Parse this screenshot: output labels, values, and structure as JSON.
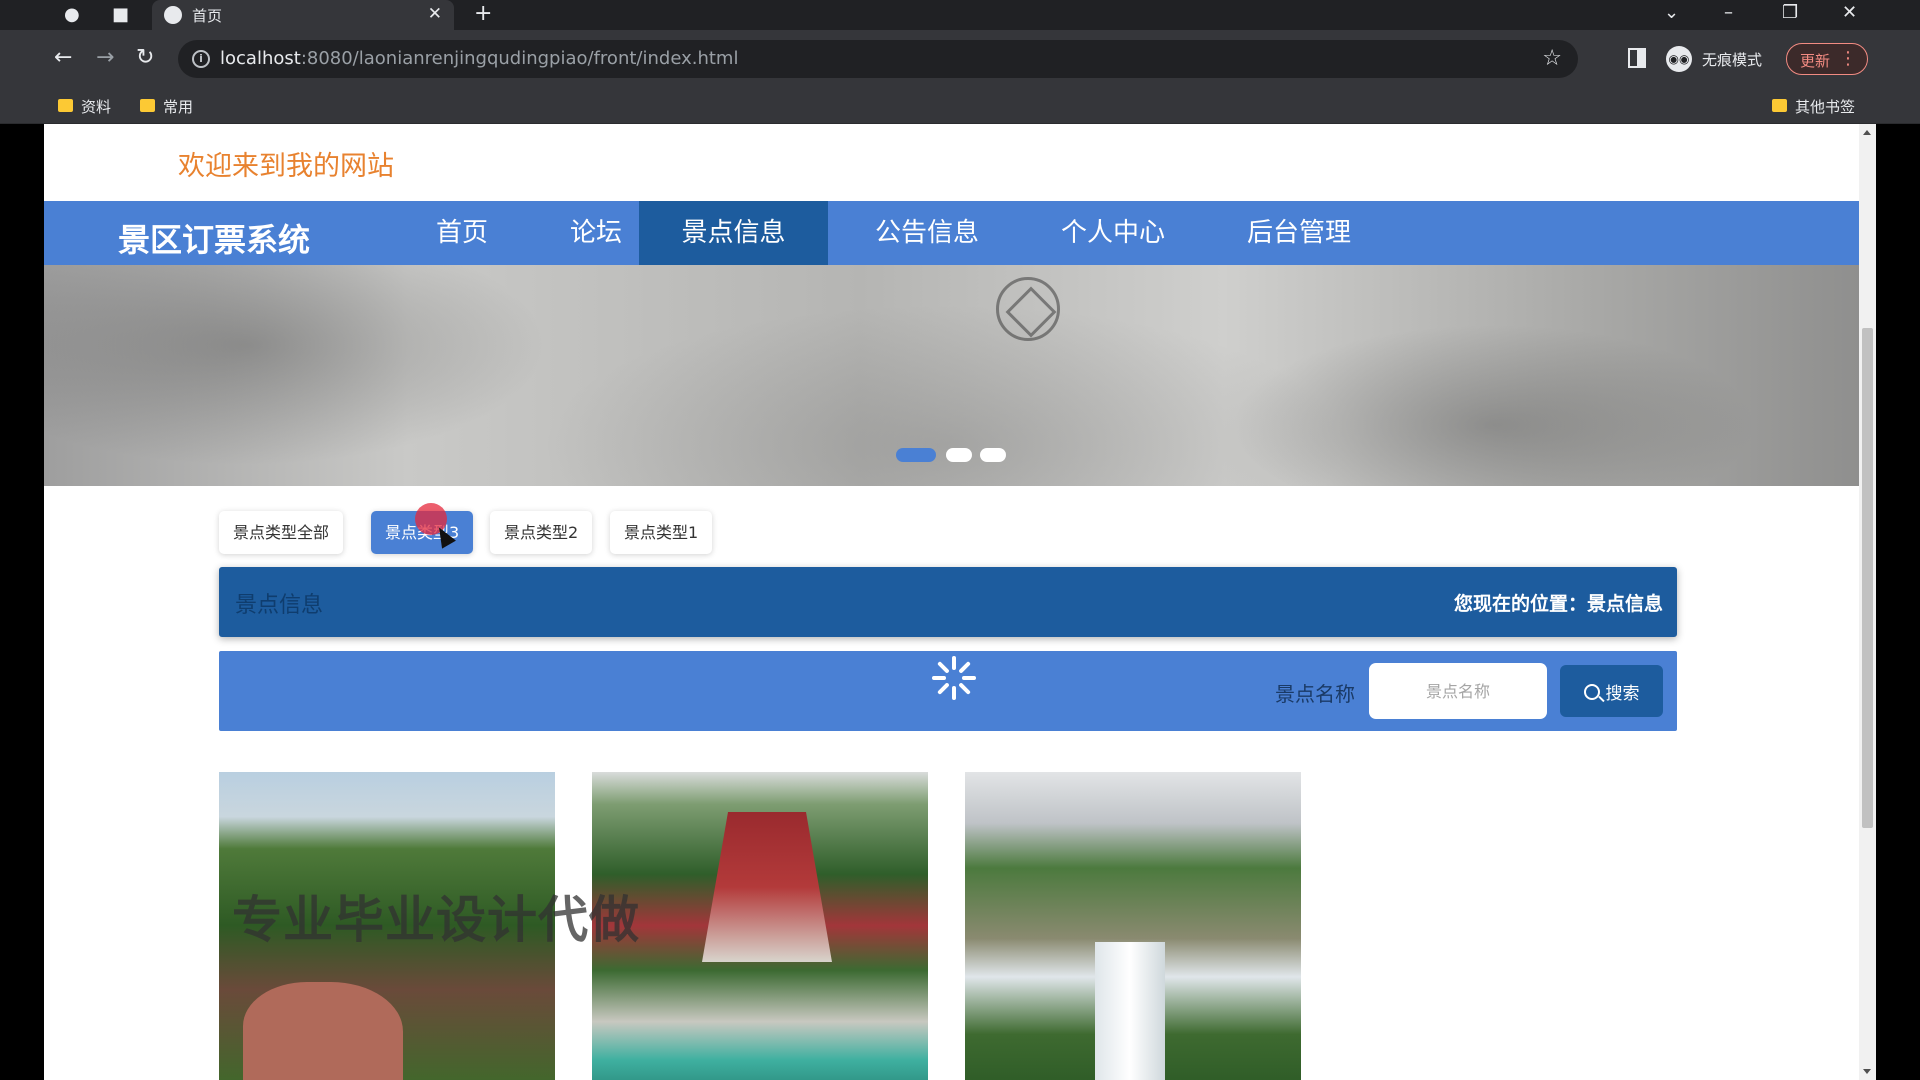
{
  "browser": {
    "tab_title": "首页",
    "url_host": "localhost",
    "url_path": ":8080/laonianrenjingqudingpiao/front/index.html",
    "incognito_label": "无痕模式",
    "update_label": "更新",
    "bookmarks": [
      "资料",
      "常用"
    ],
    "other_bookmarks": "其他书签"
  },
  "page": {
    "welcome": "欢迎来到我的网站",
    "brand": "景区订票系统",
    "nav": [
      "首页",
      "论坛",
      "景点信息",
      "公告信息",
      "个人中心",
      "后台管理"
    ],
    "active_nav_index": 2,
    "banner_slide_count": 3,
    "banner_active_slide": 1
  },
  "filters": {
    "chips": [
      "景点类型全部",
      "景点类型3",
      "景点类型2",
      "景点类型1"
    ],
    "active_index": 1
  },
  "breadcrumb": {
    "title": "景点信息",
    "location_text": "您现在的位置：景点信息"
  },
  "search": {
    "label": "景点名称",
    "placeholder": "景点名称",
    "button": "搜索"
  },
  "watermark": "专业毕业设计代做",
  "colors": {
    "nav_blue": "#4a80d4",
    "nav_active": "#1d5c9e",
    "welcome_orange": "#e8822f"
  }
}
